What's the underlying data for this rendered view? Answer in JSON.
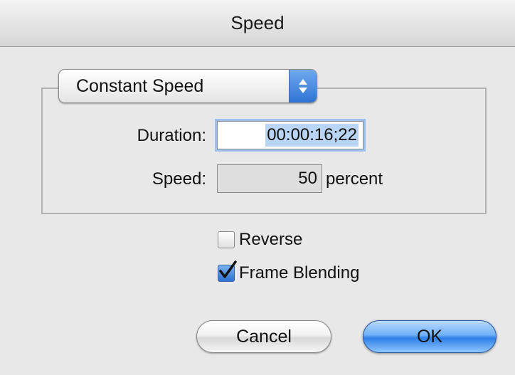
{
  "window": {
    "title": "Speed"
  },
  "speed_mode": {
    "selected": "Constant Speed"
  },
  "form": {
    "duration_label": "Duration:",
    "duration_value": "00:00:16;22",
    "speed_label": "Speed:",
    "speed_value": "50",
    "speed_unit": "percent"
  },
  "options": {
    "reverse_label": "Reverse",
    "reverse_checked": false,
    "frame_blending_label": "Frame Blending",
    "frame_blending_checked": true
  },
  "buttons": {
    "cancel_label": "Cancel",
    "ok_label": "OK"
  },
  "colors": {
    "accent": "#3d86e6",
    "window_bg": "#e8e8e8"
  },
  "icons": {
    "popup_arrows": "up-down-arrows-icon",
    "checkmark": "checkmark-icon"
  }
}
